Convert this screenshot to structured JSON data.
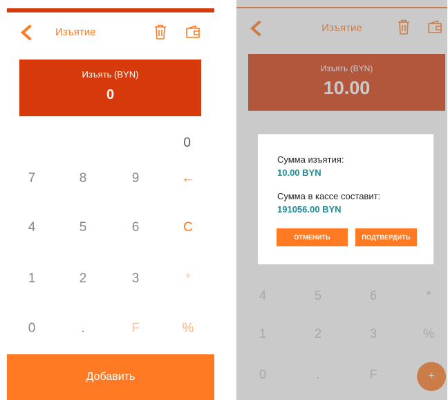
{
  "colors": {
    "accent": "#ff7a22",
    "accent_dark": "#d63a0a",
    "amount_box_dim": "#e0b6a2",
    "dim_text": "#ffd2b8",
    "teal": "#1f8c96"
  },
  "left_screen": {
    "header": {
      "title": "Изъятие",
      "back_icon": "chevron-left-icon",
      "trash_icon": "trash-icon",
      "wallet_icon": "wallet-icon"
    },
    "amount": {
      "label": "Изъять (BYN)",
      "value": "0"
    },
    "display_value": "0",
    "keypad": {
      "row1": [
        "7",
        "8",
        "9",
        "←"
      ],
      "row2": [
        "4",
        "5",
        "6",
        "C"
      ],
      "row3": [
        "1",
        "2",
        "3",
        "*"
      ],
      "row4": [
        "0",
        ".",
        "F",
        "%"
      ]
    },
    "submit_label": "Добавить"
  },
  "right_screen": {
    "header": {
      "title": "Изъятие"
    },
    "amount": {
      "label": "Изъять (BYN)",
      "value": "10.00"
    },
    "keypad": {
      "row1": [
        "4",
        "5",
        "6",
        "*"
      ],
      "row2": [
        "1",
        "2",
        "3",
        "%"
      ],
      "row3": [
        "0",
        ".",
        "F"
      ]
    },
    "fab_label": "+",
    "dialog": {
      "withdrawal_label": "Сумма изъятия:",
      "withdrawal_value": "10.00 BYN",
      "cash_label": "Сумма в кассе составит:",
      "cash_value": "191056.00 BYN",
      "cancel_label": "ОТМЕНИТЬ",
      "confirm_label": "ПОДТВЕРДИТЬ"
    }
  }
}
